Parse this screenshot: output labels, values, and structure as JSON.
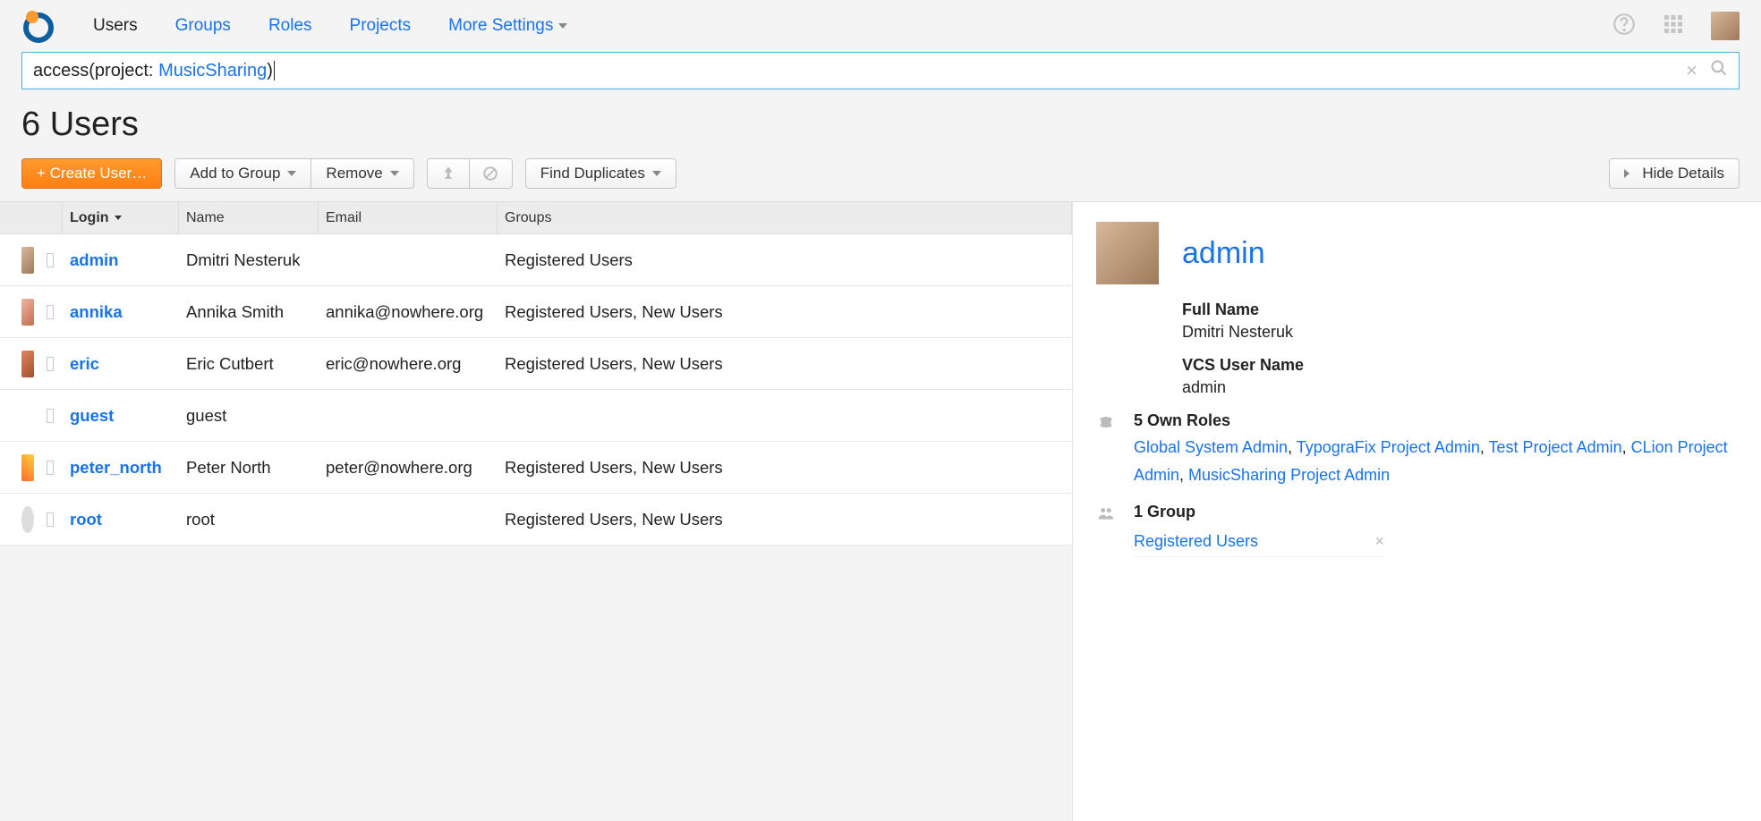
{
  "nav": {
    "items": [
      {
        "label": "Users",
        "active": true
      },
      {
        "label": "Groups"
      },
      {
        "label": "Roles"
      },
      {
        "label": "Projects"
      },
      {
        "label": "More Settings"
      }
    ]
  },
  "search": {
    "prefix": "access(project: ",
    "link": "MusicSharing",
    "suffix": ")"
  },
  "heading": "6 Users",
  "toolbar": {
    "create": "+ Create User…",
    "add_to_group": "Add to Group",
    "remove": "Remove",
    "find_duplicates": "Find Duplicates",
    "hide_details": "Hide Details"
  },
  "columns": {
    "login": "Login",
    "name": "Name",
    "email": "Email",
    "groups": "Groups"
  },
  "users": [
    {
      "login": "admin",
      "name": "Dmitri Nesteruk",
      "email": "",
      "groups": "Registered Users",
      "avatar": "ua-admin"
    },
    {
      "login": "annika",
      "name": "Annika Smith",
      "email": "annika@nowhere.org",
      "groups": "Registered Users, New Users",
      "avatar": "ua-annika"
    },
    {
      "login": "eric",
      "name": "Eric Cutbert",
      "email": "eric@nowhere.org",
      "groups": "Registered Users, New Users",
      "avatar": "ua-eric"
    },
    {
      "login": "guest",
      "name": "guest",
      "email": "",
      "groups": "",
      "avatar": "ua-none"
    },
    {
      "login": "peter_north",
      "name": "Peter North",
      "email": "peter@nowhere.org",
      "groups": "Registered Users, New Users",
      "avatar": "ua-peter"
    },
    {
      "login": "root",
      "name": "root",
      "email": "",
      "groups": "Registered Users, New Users",
      "avatar": "ua-root"
    }
  ],
  "detail": {
    "login": "admin",
    "full_name_label": "Full Name",
    "full_name": "Dmitri Nesteruk",
    "vcs_label": "VCS User Name",
    "vcs": "admin",
    "roles_label": "5 Own Roles",
    "roles": [
      "Global System Admin",
      "TypograFix Project Admin",
      "Test Project Admin",
      "CLion Project Admin",
      "MusicSharing Project Admin"
    ],
    "group_label": "1 Group",
    "group": "Registered Users"
  }
}
